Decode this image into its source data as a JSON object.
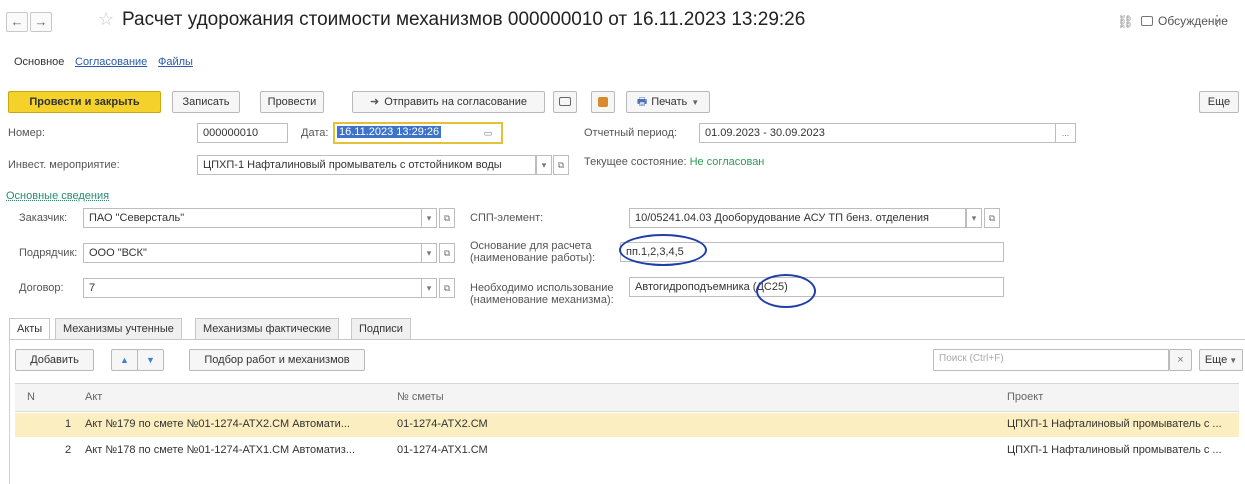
{
  "header": {
    "back_icon": "←",
    "forward_icon": "→",
    "star_icon": "☆",
    "title": "Расчет удорожания стоимости механизмов 000000010 от 16.11.2023 13:29:26",
    "link_icon": "⛓",
    "discussion_label": "Обсуждение",
    "more_icon": "⋮"
  },
  "subtabs": [
    "Основное",
    "Согласование",
    "Файлы"
  ],
  "toolbar": {
    "post_close": "Провести и закрыть",
    "save": "Записать",
    "post": "Провести",
    "send_approval": "Отправить на согласование",
    "send_icon": "➜",
    "print": "Печать",
    "print_icon": "🖶",
    "more": "Еще"
  },
  "form": {
    "number_label": "Номер:",
    "number_value": "000000010",
    "date_label": "Дата:",
    "date_value": "16.11.2023 13:29:26",
    "period_label": "Отчетный период:",
    "period_value": "01.09.2023 - 30.09.2023",
    "invest_label": "Инвест. мероприятие:",
    "invest_value": "ЦПХП-1 Нафталиновый промыватель с отстойником воды",
    "state_label": "Текущее состояние:",
    "state_value": "Не согласован",
    "section_link": "Основные сведения",
    "customer_label": "Заказчик:",
    "customer_value": "ПАО \"Северсталь\"",
    "contractor_label": "Подрядчик:",
    "contractor_value": "ООО \"ВСК\"",
    "contract_label": "Договор:",
    "contract_value": "7",
    "spp_label": "СПП-элемент:",
    "spp_value": "10/05241.04.03 Дооборудование АСУ ТП бенз. отделения",
    "basis_label": "Основание для расчета (наименование работы):",
    "basis_value": "пп.1,2,3,4,5",
    "need_label": "Необходимо использование (наименование механизма):",
    "need_value": "Автогидроподъемника (ДС25)"
  },
  "tabs": [
    "Акты",
    "Механизмы учтенные",
    "Механизмы фактические",
    "Подписи"
  ],
  "table_toolbar": {
    "add": "Добавить",
    "up_icon": "▲",
    "down_icon": "▼",
    "pick": "Подбор работ и механизмов",
    "search_placeholder": "Поиск (Ctrl+F)",
    "clear_icon": "×",
    "more": "Еще"
  },
  "table": {
    "columns": [
      "N",
      "Акт",
      "№ сметы",
      "Проект"
    ],
    "rows": [
      {
        "n": "1",
        "act": "Акт №179 по смете №01-1274-АТХ2.СМ Автомати...",
        "estimate": "01-1274-АТХ2.СМ",
        "project": "ЦПХП-1 Нафталиновый промыватель с ..."
      },
      {
        "n": "2",
        "act": "Акт №178 по смете №01-1274-АТХ1.СМ Автоматиз...",
        "estimate": "01-1274-АТХ1.СМ",
        "project": "ЦПХП-1 Нафталиновый промыватель с ..."
      }
    ]
  },
  "colors": {
    "primary_button": "#f4d22b",
    "link": "#2a5aa8",
    "state_green": "#2f9a53",
    "selected_row": "#fbeec0",
    "annotation_circle": "#1f3ea8"
  }
}
